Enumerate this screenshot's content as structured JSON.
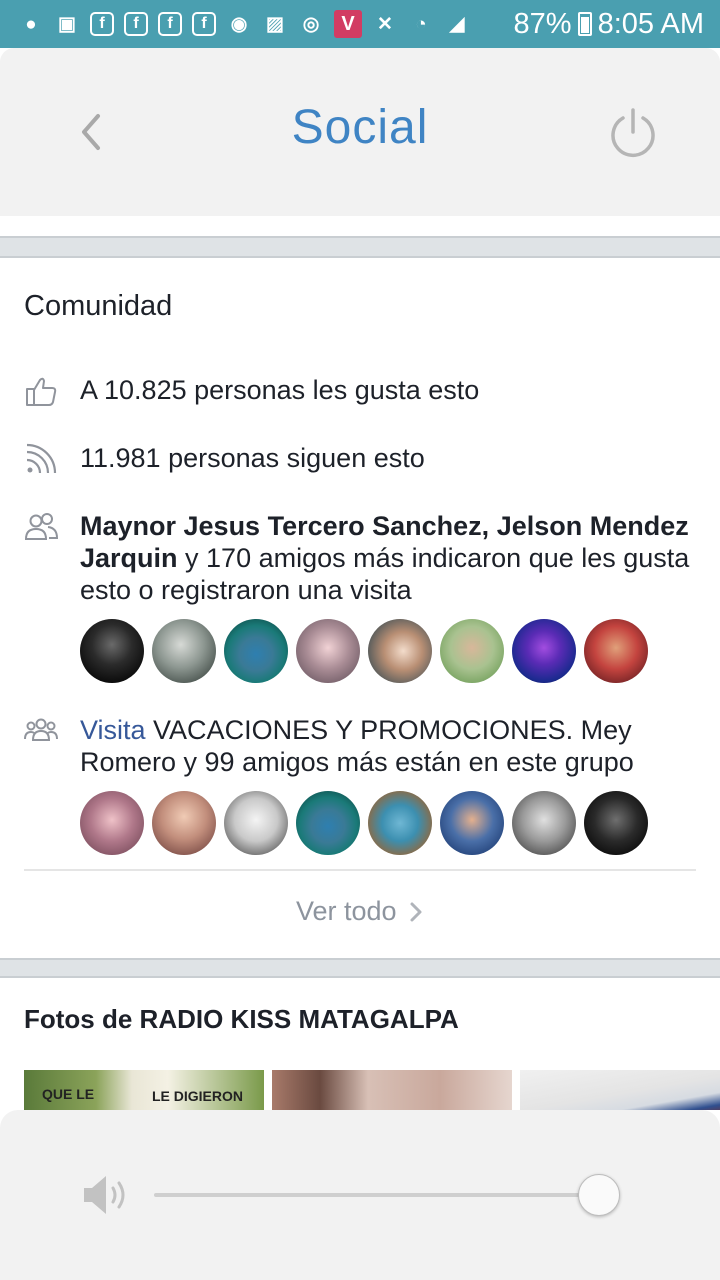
{
  "status_bar": {
    "battery_percent": "87%",
    "time": "8:05 AM",
    "icons": [
      "chat-icon",
      "radio-icon",
      "facebook-icon",
      "facebook-icon",
      "facebook-icon",
      "facebook-icon",
      "messenger-icon",
      "gallery-icon",
      "podcast-icon",
      "vivaldi-icon",
      "mute-icon",
      "wifi-icon",
      "signal-icon",
      "battery-icon"
    ]
  },
  "header": {
    "title": "Social",
    "back_icon": "chevron-left-icon",
    "power_icon": "power-icon"
  },
  "community": {
    "title": "Comunidad",
    "likes_text": "A 10.825 personas les gusta esto",
    "follows_text": "11.981 personas siguen esto",
    "friends": {
      "name1": "Maynor Jesus Tercero Sanchez",
      "sep": ", ",
      "name2": "Jelson Mendez Jarquin",
      "rest": " y 170 amigos más indicaron que les gusta esto o registraron una visita"
    },
    "group": {
      "link": "Visita",
      "rest": " VACACIONES Y PROMOCIONES. Mey Romero y 99 amigos más están en este grupo"
    },
    "see_all": "Ver todo"
  },
  "photos": {
    "title": "Fotos de RADIO KISS MATAGALPA",
    "captions": [
      "QUE LE",
      "LE DIGIERON",
      "",
      ""
    ]
  },
  "player": {
    "volume_icon": "volume-icon",
    "volume_level": 0.96
  },
  "colors": {
    "status_bar": "#4a9fb0",
    "title_blue": "#3f84c4",
    "link_blue": "#365899",
    "header_bg": "#f2f2f2"
  }
}
